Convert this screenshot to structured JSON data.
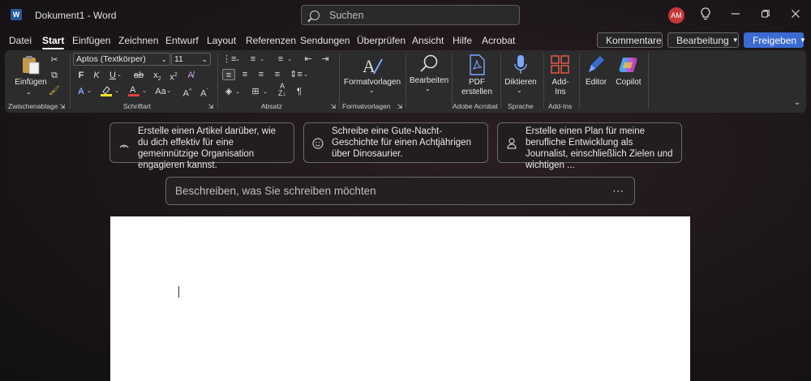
{
  "titlebar": {
    "app_logo_letter": "W",
    "title": "Dokument1 - Word",
    "search_placeholder": "Suchen",
    "avatar_initials": "AM"
  },
  "menu": {
    "tabs": [
      "Datei",
      "Start",
      "Einfügen",
      "Zeichnen",
      "Entwurf",
      "Layout",
      "Referenzen",
      "Sendungen",
      "Überprüfen",
      "Ansicht",
      "Hilfe",
      "Acrobat"
    ],
    "active_tab": "Start",
    "comments_label": "Kommentare",
    "editing_label": "Bearbeitung",
    "share_label": "Freigeben"
  },
  "ribbon": {
    "clipboard": {
      "paste_label": "Einfügen",
      "group_label": "Zwischenablage"
    },
    "font": {
      "font_name": "Aptos (Textkörper)",
      "font_size": "11",
      "group_label": "Schriftart"
    },
    "paragraph": {
      "group_label": "Absatz"
    },
    "styles": {
      "label": "Formatvorlagen",
      "group_label": "Formatvorlagen"
    },
    "editing": {
      "label": "Bearbeiten"
    },
    "acrobat": {
      "label_line1": "PDF",
      "label_line2": "erstellen",
      "group_label": "Adobe Acrobat"
    },
    "voice": {
      "label": "Diktieren",
      "group_label": "Sprache"
    },
    "addins": {
      "label_line1": "Add-",
      "label_line2": "Ins",
      "group_label": "Add-Ins"
    },
    "editor": {
      "label": "Editor"
    },
    "copilot": {
      "label": "Copilot"
    }
  },
  "copilot_prompts": [
    {
      "icon": "signal-icon",
      "text": "Erstelle einen Artikel darüber, wie du dich effektiv für eine gemeinnützige Organisation engagieren kannst."
    },
    {
      "icon": "smiley-icon",
      "text": "Schreibe eine Gute-Nacht-Geschichte für einen Achtjährigen über Dinosaurier."
    },
    {
      "icon": "person-icon",
      "text": "Erstelle einen Plan für meine berufliche Entwicklung als Journalist, einschließlich Zielen und wichtigen ..."
    }
  ],
  "prompt_input": {
    "placeholder": "Beschreiben, was Sie schreiben möchten"
  },
  "colors": {
    "accent_blue": "#3b6ad1",
    "word_blue": "#2b579a",
    "avatar_red": "#c43a3a",
    "highlight_yellow": "#f5e020",
    "font_red": "#e04040"
  }
}
